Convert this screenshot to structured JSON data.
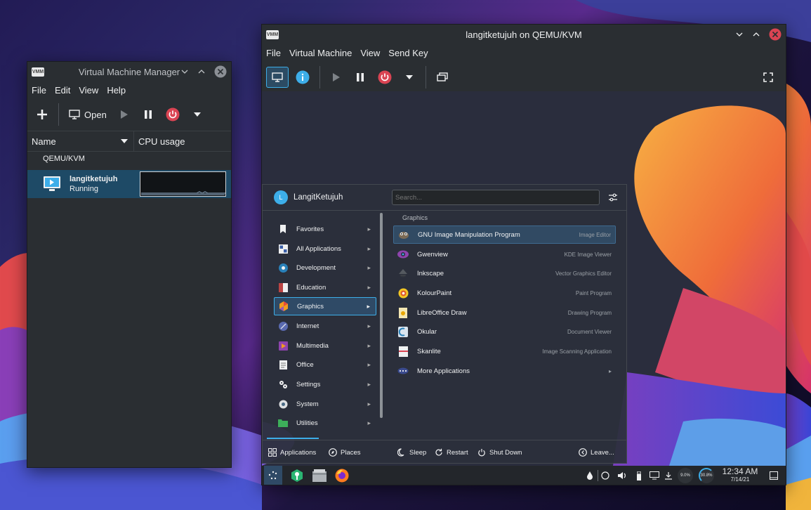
{
  "colors": {
    "accent": "#3daee9",
    "power": "#da4453",
    "selection": "#1e4a66"
  },
  "vmm": {
    "title": "Virtual Machine Manager",
    "menu": [
      "File",
      "Edit",
      "View",
      "Help"
    ],
    "toolbar": {
      "open_label": "Open"
    },
    "columns": {
      "name": "Name",
      "cpu": "CPU usage"
    },
    "group": "QEMU/KVM",
    "vm": {
      "name": "langitketujuh",
      "status": "Running"
    }
  },
  "console": {
    "title": "langitketujuh on QEMU/KVM",
    "menu": [
      "File",
      "Virtual Machine",
      "View",
      "Send Key"
    ]
  },
  "launcher": {
    "user": "LangitKetujuh",
    "user_initial": "L",
    "search_placeholder": "Search...",
    "section": "Graphics",
    "categories": [
      {
        "label": "Favorites",
        "icon": "bookmark-icon"
      },
      {
        "label": "All Applications",
        "icon": "grid-icon"
      },
      {
        "label": "Development",
        "icon": "gear-dev-icon"
      },
      {
        "label": "Education",
        "icon": "education-icon"
      },
      {
        "label": "Graphics",
        "icon": "graphics-icon"
      },
      {
        "label": "Internet",
        "icon": "globe-icon"
      },
      {
        "label": "Multimedia",
        "icon": "multimedia-icon"
      },
      {
        "label": "Office",
        "icon": "document-icon"
      },
      {
        "label": "Settings",
        "icon": "settings-icon"
      },
      {
        "label": "System",
        "icon": "system-icon"
      },
      {
        "label": "Utilities",
        "icon": "folder-icon"
      }
    ],
    "apps": [
      {
        "name": "GNU Image Manipulation Program",
        "desc": "Image Editor",
        "icon": "gimp-icon"
      },
      {
        "name": "Gwenview",
        "desc": "KDE Image Viewer",
        "icon": "gwenview-icon"
      },
      {
        "name": "Inkscape",
        "desc": "Vector Graphics Editor",
        "icon": "inkscape-icon"
      },
      {
        "name": "KolourPaint",
        "desc": "Paint Program",
        "icon": "kolourpaint-icon"
      },
      {
        "name": "LibreOffice Draw",
        "desc": "Drawing Program",
        "icon": "libreoffice-draw-icon"
      },
      {
        "name": "Okular",
        "desc": "Document Viewer",
        "icon": "okular-icon"
      },
      {
        "name": "Skanlite",
        "desc": "Image Scanning Application",
        "icon": "skanlite-icon"
      },
      {
        "name": "More Applications",
        "desc": "",
        "icon": "more-icon"
      }
    ],
    "footer": {
      "applications": "Applications",
      "places": "Places",
      "sleep": "Sleep",
      "restart": "Restart",
      "shutdown": "Shut Down",
      "leave": "Leave..."
    }
  },
  "panel": {
    "time": "12:34 AM",
    "date": "7/14/21",
    "cpu": "9.0%",
    "mem": "30.8%"
  }
}
